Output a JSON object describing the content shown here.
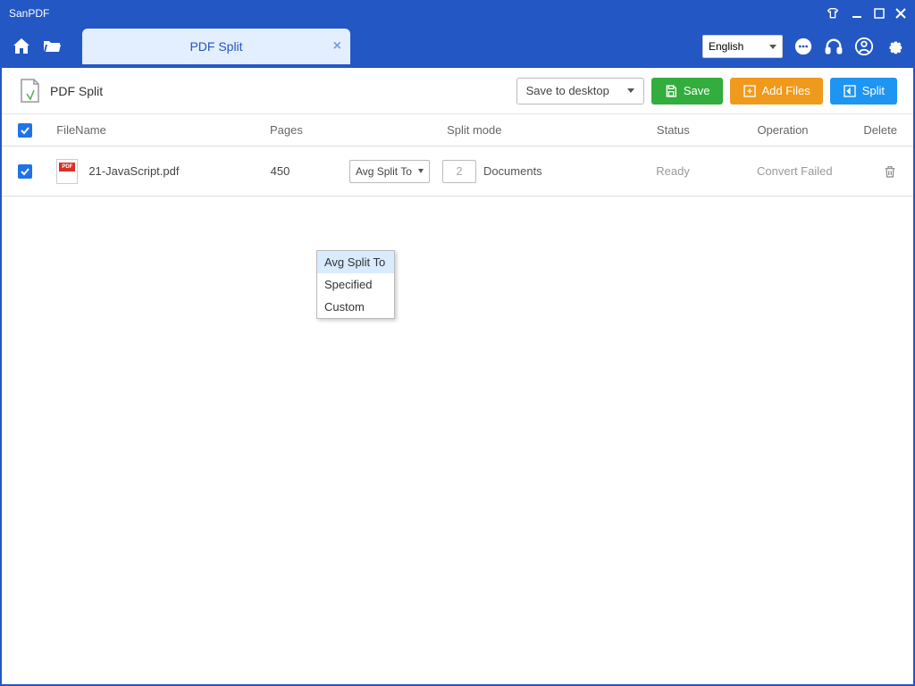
{
  "app": {
    "title": "SanPDF"
  },
  "topbar": {
    "tab_label": "PDF Split",
    "language": "English"
  },
  "toolbar": {
    "page_title": "PDF Split",
    "save_to": "Save to desktop",
    "save_label": "Save",
    "add_files_label": "Add Files",
    "split_label": "Split"
  },
  "table": {
    "headers": {
      "filename": "FileName",
      "pages": "Pages",
      "split_mode": "Split mode",
      "status": "Status",
      "operation": "Operation",
      "delete": "Delete"
    },
    "rows": [
      {
        "filename": "21-JavaScript.pdf",
        "pages": "450",
        "split_mode_selected": "Avg Split To",
        "split_count": "2",
        "split_unit": "Documents",
        "status": "Ready",
        "operation": "Convert Failed"
      }
    ]
  },
  "dropdown": {
    "options": [
      "Avg Split To",
      "Specified",
      "Custom"
    ],
    "selected_index": 0
  }
}
